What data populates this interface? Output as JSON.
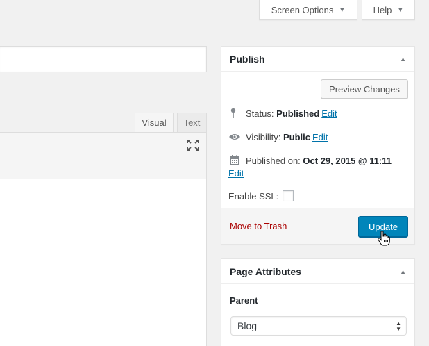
{
  "screen_meta": {
    "screen_options_label": "Screen Options",
    "help_label": "Help"
  },
  "editor": {
    "tab_visual": "Visual",
    "tab_text": "Text"
  },
  "publish": {
    "title": "Publish",
    "preview_label": "Preview Changes",
    "status_label": "Status:",
    "status_value": "Published",
    "visibility_label": "Visibility:",
    "visibility_value": "Public",
    "published_on_label": "Published on:",
    "published_on_value": "Oct 29, 2015 @ 11:11",
    "edit_label": "Edit",
    "ssl_label": "Enable SSL:",
    "trash_label": "Move to Trash",
    "update_label": "Update"
  },
  "page_attributes": {
    "title": "Page Attributes",
    "parent_label": "Parent",
    "parent_value": "Blog"
  },
  "colors": {
    "primary": "#0085ba",
    "link": "#0073aa",
    "delete": "#aa0000"
  },
  "icons": [
    "chevron-down-icon",
    "chevron-up-icon",
    "fullscreen-icon",
    "pin-icon",
    "eye-icon",
    "calendar-icon",
    "hand-cursor-icon",
    "select-arrows-icon"
  ]
}
